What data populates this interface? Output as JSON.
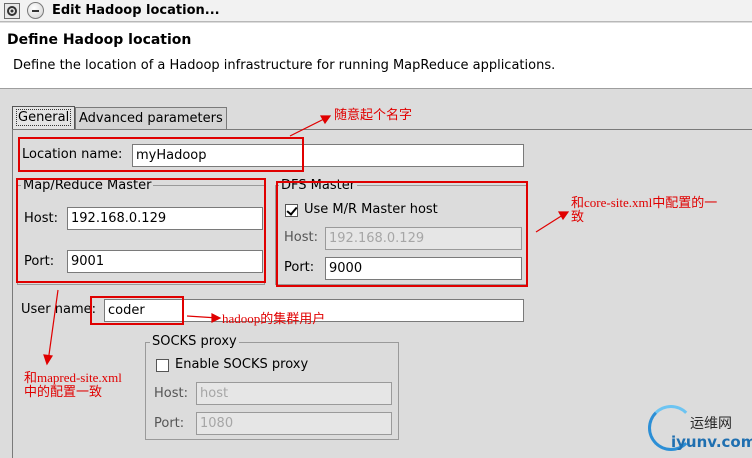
{
  "window": {
    "title": "Edit Hadoop location..."
  },
  "header": {
    "title": "Define Hadoop location",
    "description": "Define the location of a Hadoop infrastructure for running MapReduce applications."
  },
  "tabs": [
    {
      "label": "General",
      "selected": true
    },
    {
      "label": "Advanced parameters",
      "selected": false
    }
  ],
  "general": {
    "location_name": {
      "label": "Location name:",
      "value": "myHadoop"
    },
    "mapreduce_master": {
      "title": "Map/Reduce Master",
      "host_label": "Host:",
      "host_value": "192.168.0.129",
      "port_label": "Port:",
      "port_value": "9001"
    },
    "dfs_master": {
      "title": "DFS Master",
      "use_mr_label": "Use M/R Master host",
      "use_mr_checked": true,
      "host_label": "Host:",
      "host_value": "192.168.0.129",
      "port_label": "Port:",
      "port_value": "9000"
    },
    "user_name": {
      "label": "User name:",
      "value": "coder"
    },
    "socks_proxy": {
      "title": "SOCKS proxy",
      "enable_label": "Enable SOCKS proxy",
      "enable_checked": false,
      "host_label": "Host:",
      "host_value": "host",
      "port_label": "Port:",
      "port_value": "1080"
    }
  },
  "annotations": {
    "name_note": "随意起个名字",
    "core_site_note_1": "和core-site.xml中配置的一",
    "core_site_note_2": "致",
    "hadoop_user_note": "hadoop的集群用户",
    "mapred_site_note_1": "和mapred-site.xml",
    "mapred_site_note_2": "中的配置一致"
  },
  "watermark": {
    "name": "运维网",
    "url": "iyunv.com"
  },
  "colors": {
    "annotation": "#e00000",
    "header_bg": "#ffffff",
    "dialog_bg": "#dcdcdc"
  }
}
